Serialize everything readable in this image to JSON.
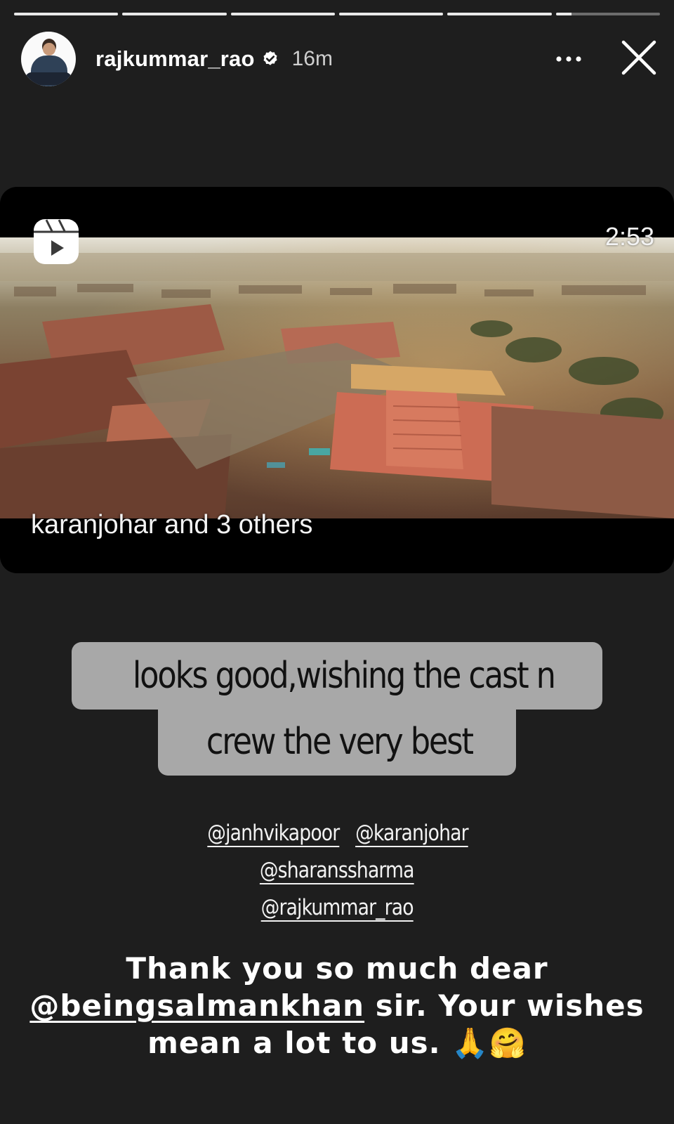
{
  "progress": {
    "segments": [
      1,
      1,
      1,
      1,
      1,
      0.15
    ]
  },
  "header": {
    "username": "rajkummar_rao",
    "verified": true,
    "time": "16m"
  },
  "reel": {
    "duration": "2:53",
    "caption": "karanjohar and 3 others",
    "icon": "reels-icon"
  },
  "sticker": {
    "line1": "looks good,wishing the  cast n",
    "line2": "crew the very best"
  },
  "mentions": {
    "m1": "@janhvikapoor",
    "m2": "@karanjohar",
    "m3": "@sharanssharma",
    "m4": "@rajkummar_rao"
  },
  "thanks": {
    "line1": "Thank you so much dear",
    "tag": "@beingsalmankhan",
    "line2_rest": " sir. Your wishes",
    "line3": "mean a lot to us. 🙏🤗"
  },
  "colors": {
    "background": "#1e1e1e",
    "sticker_bg": "#a8a8a8",
    "progress_fill": "#e9e9e9"
  }
}
